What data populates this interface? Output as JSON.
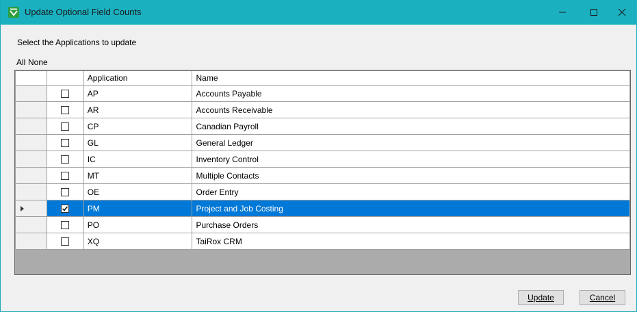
{
  "window": {
    "title": "Update Optional Field Counts",
    "colors": {
      "titlebar": "#1ab0c0",
      "selection": "#0078d7"
    }
  },
  "prompt": "Select the Applications to update",
  "selection_links": {
    "all": "All",
    "none": "None"
  },
  "grid": {
    "columns": [
      "Application",
      "Name"
    ],
    "rows": [
      {
        "app": "AP",
        "name": "Accounts Payable",
        "checked": false
      },
      {
        "app": "AR",
        "name": "Accounts Receivable",
        "checked": false
      },
      {
        "app": "CP",
        "name": "Canadian Payroll",
        "checked": false
      },
      {
        "app": "GL",
        "name": "General Ledger",
        "checked": false
      },
      {
        "app": "IC",
        "name": "Inventory Control",
        "checked": false
      },
      {
        "app": "MT",
        "name": "Multiple Contacts",
        "checked": false
      },
      {
        "app": "OE",
        "name": "Order Entry",
        "checked": false
      },
      {
        "app": "PM",
        "name": "Project and Job Costing",
        "checked": true,
        "selected": true
      },
      {
        "app": "PO",
        "name": "Purchase Orders",
        "checked": false
      },
      {
        "app": "XQ",
        "name": "TaiRox CRM",
        "checked": false
      }
    ]
  },
  "buttons": {
    "update": "Update",
    "cancel": "Cancel"
  }
}
